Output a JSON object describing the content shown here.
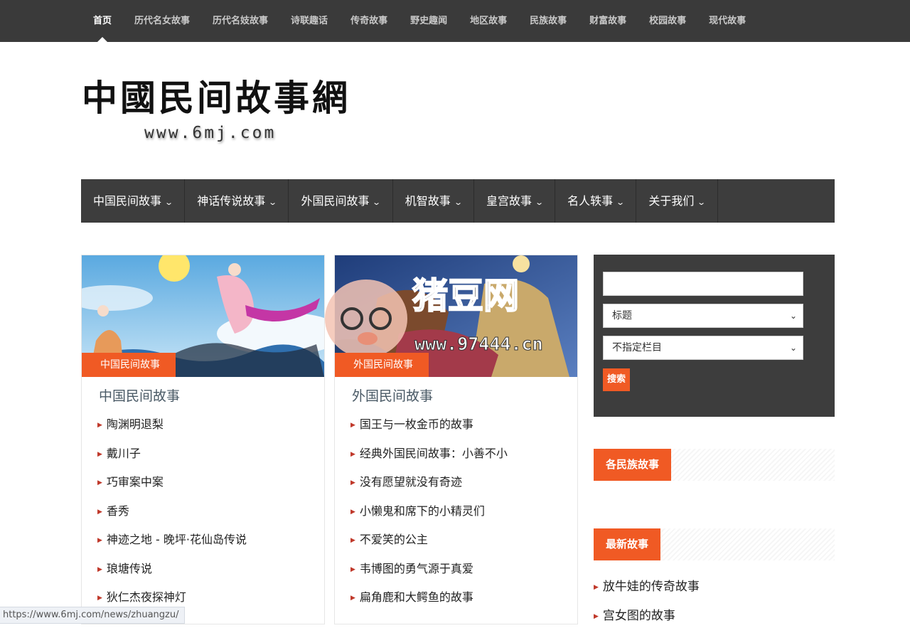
{
  "top_nav": {
    "items": [
      "首页",
      "历代名女故事",
      "历代名妓故事",
      "诗联趣话",
      "传奇故事",
      "野史趣闻",
      "地区故事",
      "民族故事",
      "财富故事",
      "校园故事",
      "现代故事"
    ]
  },
  "logo": {
    "title": "中國民间故事網",
    "url": "www.6mj.com"
  },
  "main_nav": {
    "items": [
      "中国民间故事",
      "神话传说故事",
      "外国民间故事",
      "机智故事",
      "皇宫故事",
      "名人轶事",
      "关于我们"
    ]
  },
  "cards": [
    {
      "tag": "中国民间故事",
      "title": "中国民间故事",
      "items": [
        "陶渊明退梨",
        "戴川子",
        "巧审案中案",
        "香秀",
        "神迹之地 - 晚坪·花仙岛传说",
        "琅塘传说",
        "狄仁杰夜探神灯"
      ]
    },
    {
      "tag": "外国民间故事",
      "title": "外国民间故事",
      "items": [
        "国王与一枚金币的故事",
        "经典外国民间故事：小善不小",
        "没有愿望就没有奇迹",
        "小懒鬼和席下的小精灵们",
        "不爱笑的公主",
        "韦博图的勇气源于真爱",
        "扁角鹿和大鳄鱼的故事"
      ]
    }
  ],
  "search": {
    "input_value": "",
    "field_select": "标题",
    "column_select": "不指定栏目",
    "button": "搜索"
  },
  "widgets": {
    "ethnic_title": "各民族故事",
    "latest_title": "最新故事",
    "latest_items": [
      "放牛娃的传奇故事",
      "宫女图的故事"
    ]
  },
  "watermark": {
    "text": "猪豆网",
    "url": "www.97444.cn"
  },
  "status_bar": {
    "url": "https://www.6mj.com/news/zhuangzu/"
  },
  "colors": {
    "accent": "#f05a24",
    "nav_bg": "#3d3d3d",
    "topbar_bg": "#3a3a3a"
  }
}
